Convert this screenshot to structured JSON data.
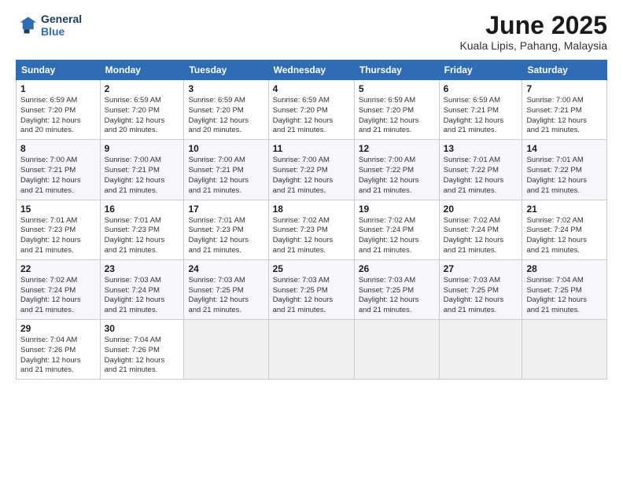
{
  "logo": {
    "line1": "General",
    "line2": "Blue"
  },
  "title": "June 2025",
  "subtitle": "Kuala Lipis, Pahang, Malaysia",
  "days_of_week": [
    "Sunday",
    "Monday",
    "Tuesday",
    "Wednesday",
    "Thursday",
    "Friday",
    "Saturday"
  ],
  "weeks": [
    [
      {
        "day": "1",
        "info": "Sunrise: 6:59 AM\nSunset: 7:20 PM\nDaylight: 12 hours\nand 20 minutes."
      },
      {
        "day": "2",
        "info": "Sunrise: 6:59 AM\nSunset: 7:20 PM\nDaylight: 12 hours\nand 20 minutes."
      },
      {
        "day": "3",
        "info": "Sunrise: 6:59 AM\nSunset: 7:20 PM\nDaylight: 12 hours\nand 20 minutes."
      },
      {
        "day": "4",
        "info": "Sunrise: 6:59 AM\nSunset: 7:20 PM\nDaylight: 12 hours\nand 21 minutes."
      },
      {
        "day": "5",
        "info": "Sunrise: 6:59 AM\nSunset: 7:20 PM\nDaylight: 12 hours\nand 21 minutes."
      },
      {
        "day": "6",
        "info": "Sunrise: 6:59 AM\nSunset: 7:21 PM\nDaylight: 12 hours\nand 21 minutes."
      },
      {
        "day": "7",
        "info": "Sunrise: 7:00 AM\nSunset: 7:21 PM\nDaylight: 12 hours\nand 21 minutes."
      }
    ],
    [
      {
        "day": "8",
        "info": "Sunrise: 7:00 AM\nSunset: 7:21 PM\nDaylight: 12 hours\nand 21 minutes."
      },
      {
        "day": "9",
        "info": "Sunrise: 7:00 AM\nSunset: 7:21 PM\nDaylight: 12 hours\nand 21 minutes."
      },
      {
        "day": "10",
        "info": "Sunrise: 7:00 AM\nSunset: 7:21 PM\nDaylight: 12 hours\nand 21 minutes."
      },
      {
        "day": "11",
        "info": "Sunrise: 7:00 AM\nSunset: 7:22 PM\nDaylight: 12 hours\nand 21 minutes."
      },
      {
        "day": "12",
        "info": "Sunrise: 7:00 AM\nSunset: 7:22 PM\nDaylight: 12 hours\nand 21 minutes."
      },
      {
        "day": "13",
        "info": "Sunrise: 7:01 AM\nSunset: 7:22 PM\nDaylight: 12 hours\nand 21 minutes."
      },
      {
        "day": "14",
        "info": "Sunrise: 7:01 AM\nSunset: 7:22 PM\nDaylight: 12 hours\nand 21 minutes."
      }
    ],
    [
      {
        "day": "15",
        "info": "Sunrise: 7:01 AM\nSunset: 7:23 PM\nDaylight: 12 hours\nand 21 minutes."
      },
      {
        "day": "16",
        "info": "Sunrise: 7:01 AM\nSunset: 7:23 PM\nDaylight: 12 hours\nand 21 minutes."
      },
      {
        "day": "17",
        "info": "Sunrise: 7:01 AM\nSunset: 7:23 PM\nDaylight: 12 hours\nand 21 minutes."
      },
      {
        "day": "18",
        "info": "Sunrise: 7:02 AM\nSunset: 7:23 PM\nDaylight: 12 hours\nand 21 minutes."
      },
      {
        "day": "19",
        "info": "Sunrise: 7:02 AM\nSunset: 7:24 PM\nDaylight: 12 hours\nand 21 minutes."
      },
      {
        "day": "20",
        "info": "Sunrise: 7:02 AM\nSunset: 7:24 PM\nDaylight: 12 hours\nand 21 minutes."
      },
      {
        "day": "21",
        "info": "Sunrise: 7:02 AM\nSunset: 7:24 PM\nDaylight: 12 hours\nand 21 minutes."
      }
    ],
    [
      {
        "day": "22",
        "info": "Sunrise: 7:02 AM\nSunset: 7:24 PM\nDaylight: 12 hours\nand 21 minutes."
      },
      {
        "day": "23",
        "info": "Sunrise: 7:03 AM\nSunset: 7:24 PM\nDaylight: 12 hours\nand 21 minutes."
      },
      {
        "day": "24",
        "info": "Sunrise: 7:03 AM\nSunset: 7:25 PM\nDaylight: 12 hours\nand 21 minutes."
      },
      {
        "day": "25",
        "info": "Sunrise: 7:03 AM\nSunset: 7:25 PM\nDaylight: 12 hours\nand 21 minutes."
      },
      {
        "day": "26",
        "info": "Sunrise: 7:03 AM\nSunset: 7:25 PM\nDaylight: 12 hours\nand 21 minutes."
      },
      {
        "day": "27",
        "info": "Sunrise: 7:03 AM\nSunset: 7:25 PM\nDaylight: 12 hours\nand 21 minutes."
      },
      {
        "day": "28",
        "info": "Sunrise: 7:04 AM\nSunset: 7:25 PM\nDaylight: 12 hours\nand 21 minutes."
      }
    ],
    [
      {
        "day": "29",
        "info": "Sunrise: 7:04 AM\nSunset: 7:26 PM\nDaylight: 12 hours\nand 21 minutes."
      },
      {
        "day": "30",
        "info": "Sunrise: 7:04 AM\nSunset: 7:26 PM\nDaylight: 12 hours\nand 21 minutes."
      },
      {
        "day": "",
        "info": ""
      },
      {
        "day": "",
        "info": ""
      },
      {
        "day": "",
        "info": ""
      },
      {
        "day": "",
        "info": ""
      },
      {
        "day": "",
        "info": ""
      }
    ]
  ]
}
